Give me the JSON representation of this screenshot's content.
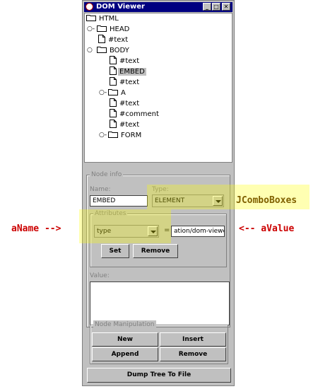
{
  "window": {
    "title": "DOM Viewer",
    "controls": {
      "minimize": "_",
      "maximize": "□",
      "close": "✕"
    }
  },
  "tree": {
    "html": "HTML",
    "head": "HEAD",
    "head_text": "#text",
    "body": "BODY",
    "body_text1": "#text",
    "embed": "EMBED",
    "body_text2": "#text",
    "a": "A",
    "a_text1": "#text",
    "a_comment": "#comment",
    "a_text2": "#text",
    "form": "FORM"
  },
  "node_info": {
    "title": "Node info",
    "name_label": "Name:",
    "name_value": "EMBED",
    "type_label": "Type:",
    "type_value": "ELEMENT"
  },
  "attributes": {
    "title": "Attributes",
    "name_value": "type",
    "equals": "=",
    "value_value": "ation/dom-viewer",
    "set_label": "Set",
    "remove_label": "Remove"
  },
  "value": {
    "label": "Value:",
    "text": ""
  },
  "node_manipulation": {
    "title": "Node Manipulation",
    "new_label": "New",
    "insert_label": "Insert",
    "append_label": "Append",
    "remove_label": "Remove"
  },
  "dump_label": "Dump Tree To File",
  "annotations": {
    "jcombo": "JComboBoxes",
    "aname": "aName -->",
    "avalue": "<-- aValue"
  },
  "colors": {
    "annotation_red": "#cc0000",
    "annotation_brown": "#806000",
    "highlight": "#ffff00",
    "title_bar": "#000080"
  }
}
